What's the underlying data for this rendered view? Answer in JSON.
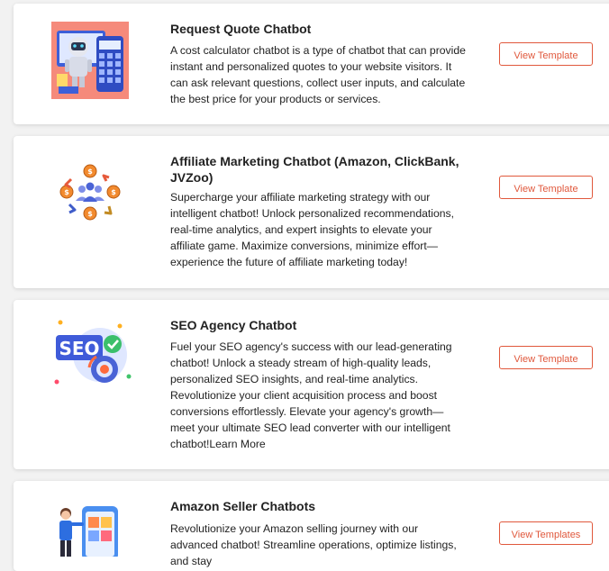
{
  "cards": [
    {
      "title": "Request Quote Chatbot",
      "description": "A cost calculator chatbot is a type of chatbot that can provide instant and personalized quotes to your website visitors. It can ask relevant questions, collect user inputs, and calculate the best price for your products or services.",
      "button": "View Template",
      "icon": "calculator-robot-icon"
    },
    {
      "title": "Affiliate Marketing Chatbot (Amazon, ClickBank, JVZoo)",
      "description": "Supercharge your affiliate marketing strategy with our intelligent chatbot! Unlock personalized recommendations, real-time analytics, and expert insights to elevate your affiliate game. Maximize conversions, minimize effort—experience the future of affiliate marketing today!",
      "button": "View Template",
      "icon": "affiliate-network-icon"
    },
    {
      "title": "SEO Agency Chatbot",
      "description": "Fuel your SEO agency's success with our lead-generating chatbot! Unlock a steady stream of high-quality leads, personalized SEO insights, and real-time analytics. Revolutionize your client acquisition process and boost conversions effortlessly. Elevate your agency's growth—meet your ultimate SEO lead converter with our intelligent chatbot!Learn More",
      "button": "View Template",
      "icon": "seo-gear-icon",
      "icon_text": "SEO"
    },
    {
      "title": "Amazon Seller Chatbots",
      "description": "Revolutionize your Amazon selling journey with our advanced chatbot! Streamline operations, optimize listings, and stay",
      "button": "View Templates",
      "icon": "amazon-seller-phone-icon"
    }
  ],
  "colors": {
    "accent": "#e0583c",
    "page_background": "#f2f2f2",
    "card_background": "#ffffff"
  }
}
